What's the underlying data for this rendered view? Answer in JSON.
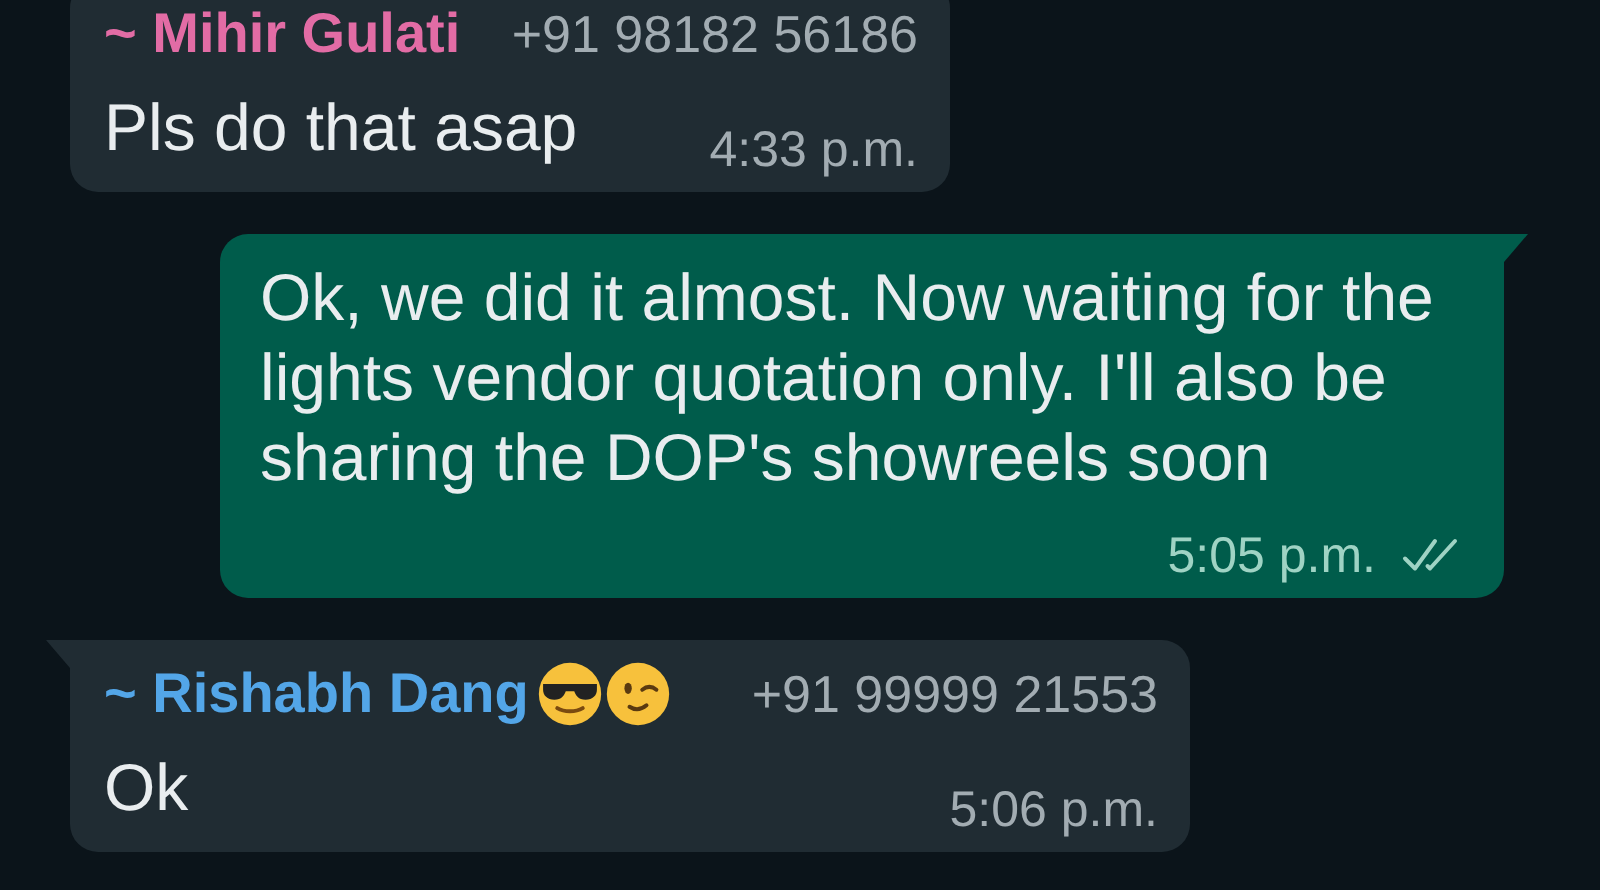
{
  "messages": [
    {
      "kind": "incoming",
      "sender": "~ Mihir Gulati",
      "color": "#e26ca5",
      "phone": "+91 98182 56186",
      "text": "Pls do that asap",
      "time": "4:33 p.m.",
      "tail": false
    },
    {
      "kind": "outgoing",
      "text": "Ok, we did it almost. Now waiting for the lights vendor quotation only. I'll also be sharing the DOP's showreels soon",
      "time": "5:05 p.m.",
      "read": false,
      "tail": true
    },
    {
      "kind": "incoming",
      "sender": "~ Rishabh Dang",
      "color": "#53a6e8",
      "emojis": [
        {
          "kind": "sunglasses"
        },
        {
          "kind": "wink"
        }
      ],
      "phone": "+91 99999 21553",
      "text": "Ok",
      "time": "5:06 p.m.",
      "tail": true
    }
  ]
}
